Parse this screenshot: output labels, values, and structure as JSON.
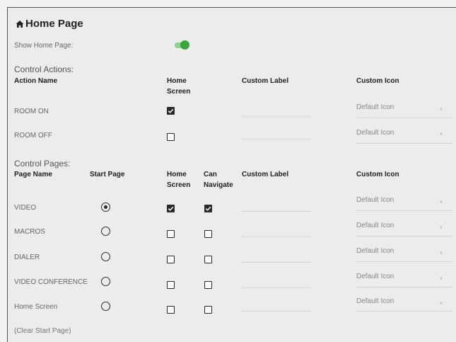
{
  "page_title": "Home Page",
  "show_home_page": {
    "label": "Show Home Page:",
    "enabled": true
  },
  "control_actions": {
    "section_label": "Control Actions:",
    "headers": {
      "action_name": "Action Name",
      "home_screen_1": "Home",
      "home_screen_2": "Screen",
      "custom_label": "Custom Label",
      "custom_icon": "Custom Icon"
    },
    "rows": [
      {
        "name": "ROOM ON",
        "home_screen": true,
        "custom_label": "",
        "custom_icon": "Default Icon"
      },
      {
        "name": "ROOM OFF",
        "home_screen": false,
        "custom_label": "",
        "custom_icon": "Default Icon"
      }
    ]
  },
  "control_pages": {
    "section_label": "Control Pages:",
    "headers": {
      "page_name": "Page Name",
      "start_page": "Start Page",
      "home_screen_1": "Home",
      "home_screen_2": "Screen",
      "can_navigate_1": "Can",
      "can_navigate_2": "Navigate",
      "custom_label": "Custom Label",
      "custom_icon": "Custom Icon"
    },
    "rows": [
      {
        "name": "VIDEO",
        "start_page": true,
        "home_screen": true,
        "can_navigate": true,
        "custom_label": "",
        "custom_icon": "Default Icon"
      },
      {
        "name": "MACROS",
        "start_page": false,
        "home_screen": false,
        "can_navigate": false,
        "custom_label": "",
        "custom_icon": "Default Icon"
      },
      {
        "name": "DIALER",
        "start_page": false,
        "home_screen": false,
        "can_navigate": false,
        "custom_label": "",
        "custom_icon": "Default Icon"
      },
      {
        "name": "VIDEO CONFERENCE",
        "start_page": false,
        "home_screen": false,
        "can_navigate": false,
        "custom_label": "",
        "custom_icon": "Default Icon"
      },
      {
        "name": "Home Screen",
        "start_page": false,
        "home_screen": false,
        "can_navigate": false,
        "custom_label": "",
        "custom_icon": "Default Icon"
      }
    ],
    "clear_start_page": "(Clear Start Page)"
  },
  "colors": {
    "toggle_on": "#3aa63a",
    "toggle_track": "#8fcf8f",
    "checkbox": "#2a2a2a"
  }
}
